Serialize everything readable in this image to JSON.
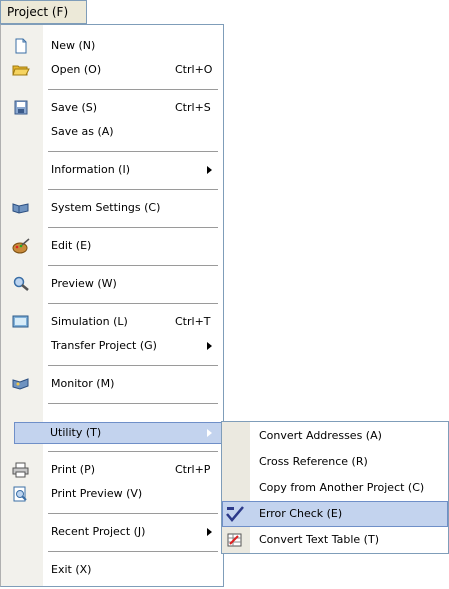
{
  "menubar": {
    "project_label": "Project (F)"
  },
  "menu": {
    "items": [
      {
        "label": "New (N)",
        "shortcut": ""
      },
      {
        "label": "Open (O)",
        "shortcut": "Ctrl+O"
      },
      {
        "label": "Save (S)",
        "shortcut": "Ctrl+S"
      },
      {
        "label": "Save as (A)",
        "shortcut": ""
      },
      {
        "label": "Information (I)",
        "shortcut": ""
      },
      {
        "label": "System Settings (C)",
        "shortcut": ""
      },
      {
        "label": "Edit (E)",
        "shortcut": ""
      },
      {
        "label": "Preview (W)",
        "shortcut": ""
      },
      {
        "label": "Simulation  (L)",
        "shortcut": "Ctrl+T"
      },
      {
        "label": "Transfer Project (G)",
        "shortcut": ""
      },
      {
        "label": "Monitor (M)",
        "shortcut": ""
      },
      {
        "label": "Utility (T)",
        "shortcut": ""
      },
      {
        "label": "Print  (P)",
        "shortcut": "Ctrl+P"
      },
      {
        "label": "Print Preview (V)",
        "shortcut": ""
      },
      {
        "label": "Recent Project (J)",
        "shortcut": ""
      },
      {
        "label": "Exit (X)",
        "shortcut": ""
      }
    ]
  },
  "submenu": {
    "items": [
      {
        "label": "Convert Addresses (A)"
      },
      {
        "label": "Cross Reference (R)"
      },
      {
        "label": "Copy from Another Project (C)"
      },
      {
        "label": "Error Check (E)"
      },
      {
        "label": "Convert Text Table (T)"
      }
    ]
  },
  "colors": {
    "highlight": "#c3d3ee",
    "highlight_border": "#6f8fc8",
    "gutter": "#f2f1ec"
  }
}
